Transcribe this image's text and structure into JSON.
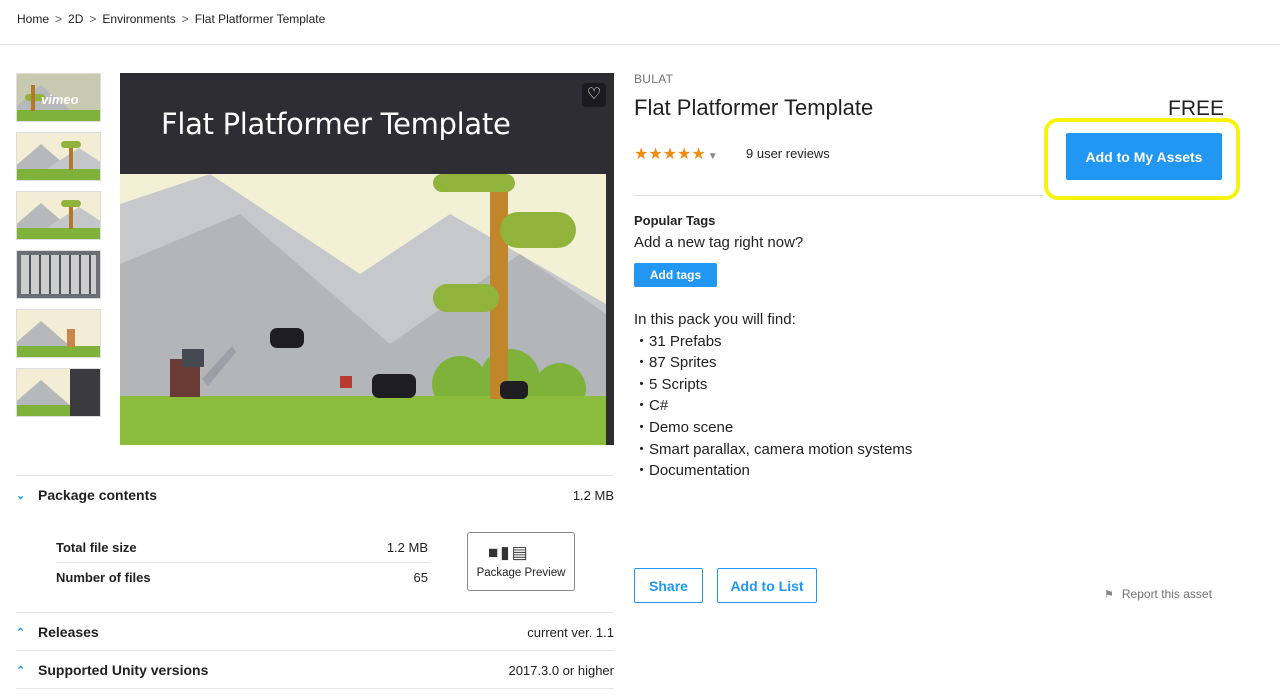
{
  "breadcrumb": [
    "Home",
    "2D",
    "Environments",
    "Flat Platformer Template"
  ],
  "thumbs": {
    "vimeo_label": "vimeo"
  },
  "hero": {
    "title": "Flat Platformer Template",
    "heart": "♡"
  },
  "product": {
    "publisher": "BULAT",
    "title": "Flat Platformer Template",
    "price": "FREE",
    "rating_stars": "★★★★★",
    "reviews": "9 user reviews",
    "add_button": "Add to My Assets"
  },
  "tags": {
    "heading": "Popular Tags",
    "subtext": "Add a new tag right now?",
    "button": "Add tags"
  },
  "description": {
    "intro": "In this pack you will find:",
    "items": [
      "・31 Prefabs",
      "・87 Sprites",
      "・5 Scripts",
      "・C#",
      "・Demo scene",
      "・Smart parallax, camera motion systems",
      "・Documentation"
    ]
  },
  "actions": {
    "share": "Share",
    "add_to_list": "Add to List",
    "report": "Report this asset"
  },
  "package": {
    "label": "Package contents",
    "size": "1.2 MB",
    "total_label": "Total file size",
    "total_value": "1.2 MB",
    "files_label": "Number of files",
    "files_value": "65",
    "preview_label": "Package Preview"
  },
  "releases": {
    "label": "Releases",
    "value": "current ver. 1.1"
  },
  "unity": {
    "label": "Supported Unity versions",
    "value": "2017.3.0 or higher"
  },
  "colors": {
    "accent": "#2196f3",
    "highlight": "#f7f30c",
    "star": "#f08c10"
  }
}
